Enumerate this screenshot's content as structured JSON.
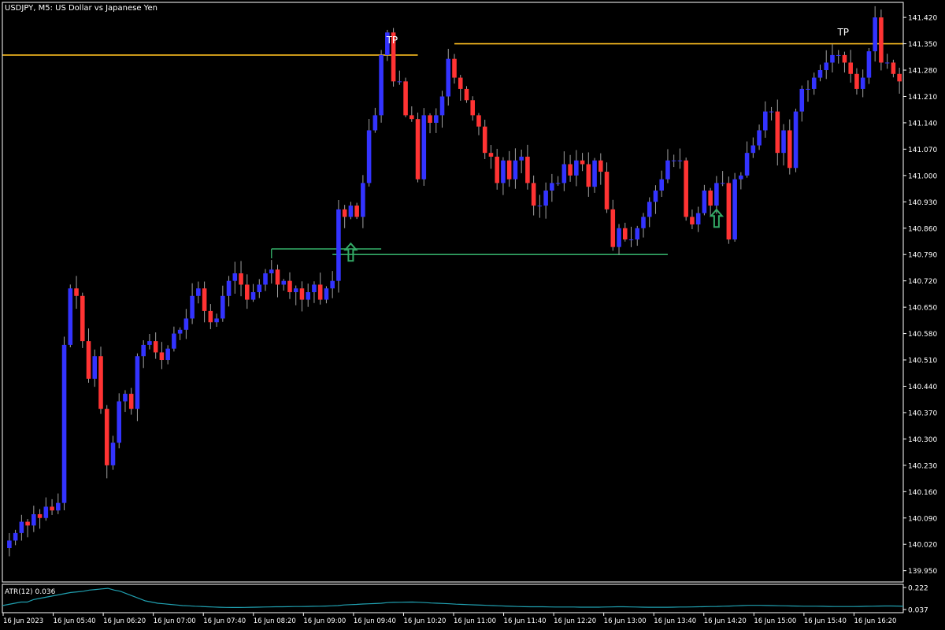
{
  "header": {
    "title": "USDJPY, M5:  US Dollar vs Japanese Yen"
  },
  "colors": {
    "background": "#000000",
    "bull": "#3333ff",
    "bear": "#ff3333",
    "wick": "#a0a0a0",
    "level_line": "#ffc020",
    "signal": "#33aa66",
    "atr_line": "#20a0b0",
    "frame": "#ffffff"
  },
  "chart_data": {
    "type": "candlestick",
    "symbol": "USDJPY",
    "timeframe": "M5",
    "ylim": [
      139.92,
      141.46
    ],
    "price_ticks": [
      "141.420",
      "141.350",
      "141.280",
      "141.210",
      "141.140",
      "141.070",
      "141.000",
      "140.930",
      "140.860",
      "140.790",
      "140.720",
      "140.650",
      "140.580",
      "140.510",
      "140.440",
      "140.370",
      "140.300",
      "140.230",
      "140.160",
      "140.090",
      "140.020",
      "139.950"
    ],
    "time_labels": [
      "16 Jun 2023",
      "16 Jun 05:40",
      "16 Jun 06:20",
      "16 Jun 07:00",
      "16 Jun 07:40",
      "16 Jun 08:20",
      "16 Jun 09:00",
      "16 Jun 09:40",
      "16 Jun 10:20",
      "16 Jun 11:00",
      "16 Jun 11:40",
      "16 Jun 12:20",
      "16 Jun 13:00",
      "16 Jun 13:40",
      "16 Jun 14:20",
      "16 Jun 15:00",
      "16 Jun 15:40",
      "16 Jun 16:20"
    ],
    "closes": [
      140.03,
      140.05,
      140.08,
      140.07,
      140.1,
      140.09,
      140.12,
      140.11,
      140.13,
      140.55,
      140.7,
      140.68,
      140.56,
      140.46,
      140.52,
      140.38,
      140.23,
      140.29,
      140.4,
      140.42,
      140.38,
      140.52,
      140.55,
      140.56,
      140.53,
      140.51,
      140.54,
      140.58,
      140.59,
      140.62,
      140.68,
      140.7,
      140.64,
      140.61,
      140.62,
      140.68,
      140.72,
      140.74,
      140.71,
      140.67,
      140.69,
      140.71,
      140.74,
      140.75,
      140.71,
      140.72,
      140.69,
      140.7,
      140.67,
      140.69,
      140.71,
      140.67,
      140.7,
      140.72,
      140.91,
      140.89,
      140.92,
      140.89,
      140.98,
      141.12,
      141.16,
      141.32,
      141.38,
      141.25,
      141.25,
      141.16,
      141.15,
      140.99,
      141.16,
      141.14,
      141.16,
      141.21,
      141.31,
      141.26,
      141.23,
      141.2,
      141.16,
      141.13,
      141.06,
      141.05,
      140.98,
      141.04,
      140.99,
      141.04,
      141.05,
      140.98,
      140.92,
      140.92,
      140.96,
      140.98,
      140.98,
      141.03,
      141.0,
      141.04,
      141.03,
      140.97,
      141.04,
      141.01,
      140.91,
      140.81,
      140.86,
      140.83,
      140.83,
      140.86,
      140.89,
      140.93,
      140.96,
      140.99,
      141.04,
      141.04,
      141.04,
      140.89,
      140.87,
      140.9,
      140.96,
      140.92,
      140.98,
      140.98,
      140.83,
      140.99,
      141.0,
      141.06,
      141.08,
      141.12,
      141.17,
      141.17,
      141.06,
      141.12,
      141.02,
      141.17,
      141.23,
      141.23,
      141.26,
      141.28,
      141.3,
      141.32,
      141.32,
      141.3,
      141.27,
      141.23,
      141.26,
      141.33,
      141.42,
      141.3,
      141.3,
      141.27,
      141.25
    ],
    "levels": [
      {
        "price": 141.32
      },
      {
        "price": 141.35
      },
      {
        "price": 140.805
      },
      {
        "price": 140.79
      }
    ],
    "annotations": [
      {
        "text": "TP",
        "index": 63,
        "price": 141.36
      },
      {
        "text": "TP",
        "index": 137,
        "price": 141.38
      }
    ],
    "signals": [
      {
        "type": "buy-arrow",
        "index": 56,
        "price": 140.79
      },
      {
        "type": "buy-arrow",
        "index": 116,
        "price": 140.88
      }
    ],
    "indicator": {
      "label": "ATR(12) 0.036",
      "name": "ATR",
      "period": 12,
      "current": 0.036,
      "ylim": [
        0.037,
        0.222
      ],
      "ticks": [
        "0.222",
        "0.037"
      ],
      "values": [
        0.07,
        0.08,
        0.09,
        0.1,
        0.1,
        0.12,
        0.13,
        0.14,
        0.15,
        0.16,
        0.17,
        0.18,
        0.185,
        0.19,
        0.2,
        0.205,
        0.21,
        0.215,
        0.2,
        0.19,
        0.17,
        0.15,
        0.13,
        0.11,
        0.1,
        0.09,
        0.085,
        0.08,
        0.075,
        0.07,
        0.068,
        0.065,
        0.063,
        0.06,
        0.058,
        0.056,
        0.055,
        0.054,
        0.054,
        0.055,
        0.056,
        0.057,
        0.058,
        0.059,
        0.06,
        0.06,
        0.061,
        0.062,
        0.062,
        0.063,
        0.064,
        0.065,
        0.066,
        0.068,
        0.07,
        0.075,
        0.078,
        0.08,
        0.083,
        0.085,
        0.087,
        0.09,
        0.095,
        0.097,
        0.098,
        0.099,
        0.1,
        0.098,
        0.095,
        0.092,
        0.09,
        0.088,
        0.085,
        0.082,
        0.08,
        0.078,
        0.076,
        0.074,
        0.072,
        0.07,
        0.068,
        0.066,
        0.064,
        0.062,
        0.061,
        0.06,
        0.06,
        0.06,
        0.059,
        0.058,
        0.058,
        0.058,
        0.058,
        0.057,
        0.057,
        0.057,
        0.057,
        0.058,
        0.059,
        0.06,
        0.06,
        0.059,
        0.058,
        0.057,
        0.056,
        0.056,
        0.056,
        0.056,
        0.057,
        0.058,
        0.058,
        0.059,
        0.06,
        0.061,
        0.062,
        0.063,
        0.065,
        0.066,
        0.068,
        0.07,
        0.072,
        0.072,
        0.072,
        0.071,
        0.07,
        0.069,
        0.068,
        0.067,
        0.066,
        0.065,
        0.065,
        0.065,
        0.064,
        0.063,
        0.062,
        0.062,
        0.062,
        0.062,
        0.063,
        0.064,
        0.065,
        0.066,
        0.067,
        0.067,
        0.066,
        0.064
      ]
    }
  }
}
